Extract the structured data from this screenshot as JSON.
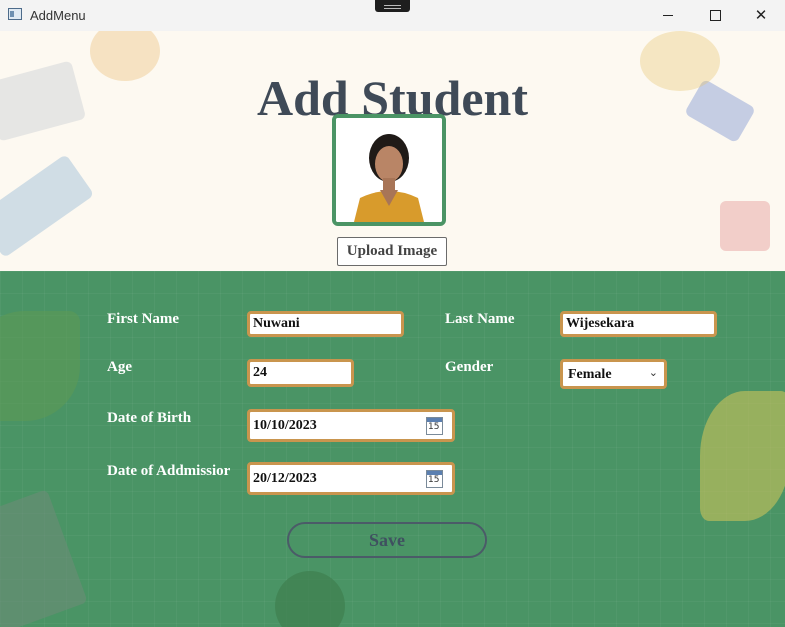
{
  "window": {
    "title": "AddMenu",
    "min_icon": "minimize-icon",
    "max_icon": "maximize-icon",
    "close_icon": "close-icon",
    "close_glyph": "✕"
  },
  "page": {
    "title": "Add Student"
  },
  "photo": {
    "upload_label": "Upload Image"
  },
  "form": {
    "first_name": {
      "label": "First Name",
      "value": "Nuwani"
    },
    "last_name": {
      "label": "Last Name",
      "value": "Wijesekara"
    },
    "age": {
      "label": "Age",
      "value": "24"
    },
    "gender": {
      "label": "Gender",
      "value": "Female",
      "chevron": "⌄"
    },
    "dob": {
      "label": "Date of Birth",
      "value": "10/10/2023",
      "calendar_day": "15"
    },
    "doa": {
      "label": "Date of Addmissior",
      "value": "20/12/2023",
      "calendar_day": "15"
    }
  },
  "save_label": "Save",
  "colors": {
    "green": "#4a9465",
    "field_border": "#c9954e",
    "title": "#3f4a57"
  }
}
